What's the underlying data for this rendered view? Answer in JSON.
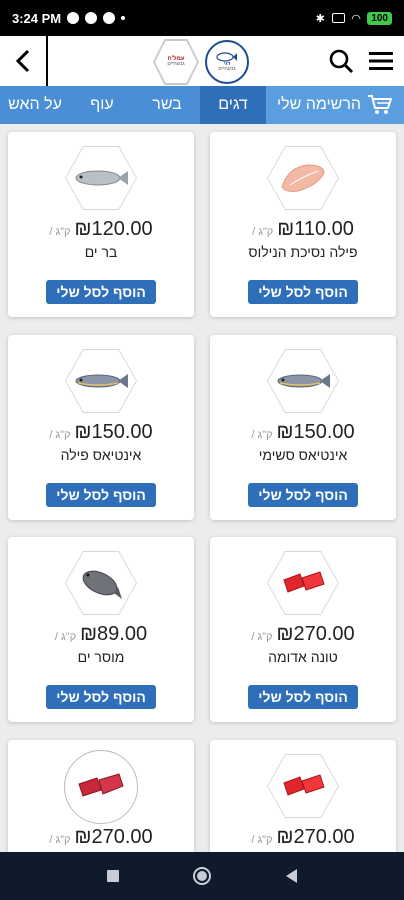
{
  "status": {
    "time": "3:24 PM",
    "battery": "100"
  },
  "header": {
    "logo_left_text": "עמל'ח",
    "logo_left_sub": "גבעתיים",
    "logo_right_text": "דגי",
    "logo_right_sub": "גבעתיים"
  },
  "tabs": {
    "my_list": "הרשימה שלי",
    "fish": "דגים",
    "meat": "בשר",
    "chicken": "עוף",
    "grill": "על האש"
  },
  "products": [
    {
      "price": "₪110.00",
      "unit": "/ ק\"ג",
      "name": "פילה נסיכת הנילוס",
      "button": "הוסף לסל שלי",
      "image": "fillet-image"
    },
    {
      "price": "₪120.00",
      "unit": "/ ק\"ג",
      "name": "בר ים",
      "button": "הוסף לסל שלי",
      "image": "fish-image"
    },
    {
      "price": "₪150.00",
      "unit": "/ ק\"ג",
      "name": "אינטיאס סשימי",
      "button": "הוסף לסל שלי",
      "image": "fish-image"
    },
    {
      "price": "₪150.00",
      "unit": "/ ק\"ג",
      "name": "אינטיאס פילה",
      "button": "הוסף לסל שלי",
      "image": "fish-image"
    },
    {
      "price": "₪270.00",
      "unit": "/ ק\"ג",
      "name": "טונה אדומה",
      "button": "הוסף לסל שלי",
      "image": "tuna-image"
    },
    {
      "price": "₪89.00",
      "unit": "/ ק\"ג",
      "name": "מוסר ים",
      "button": "הוסף לסל שלי",
      "image": "fish-image"
    },
    {
      "price": "₪270.00",
      "unit": "/ ק\"ג",
      "name": "",
      "button": "",
      "image": "tuna-image"
    },
    {
      "price": "₪270.00",
      "unit": "/ ק\"ג",
      "name": "",
      "button": "",
      "image": "tuna-image"
    }
  ]
}
